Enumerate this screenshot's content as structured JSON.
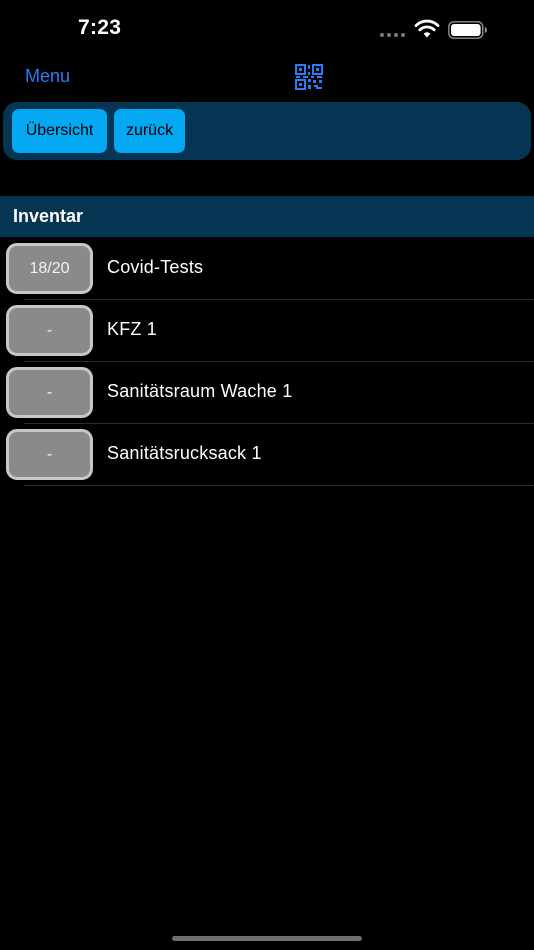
{
  "status_bar": {
    "time": "7:23",
    "icons": [
      "signal-dots-icon",
      "wifi-icon",
      "battery-icon"
    ]
  },
  "nav": {
    "menu_label": "Menu",
    "qr_icon": "qr-code-icon",
    "accent_color": "#2a7df7"
  },
  "toolbar": {
    "overview_label": "Übersicht",
    "back_label": "zurück",
    "button_color": "#04a7f2",
    "panel_color": "#053552"
  },
  "section": {
    "title": "Inventar"
  },
  "items": [
    {
      "count": "18/20",
      "label": "Covid-Tests"
    },
    {
      "count": "-",
      "label": "KFZ 1"
    },
    {
      "count": "-",
      "label": "Sanitätsraum Wache 1"
    },
    {
      "count": "-",
      "label": "Sanitätsrucksack 1"
    }
  ]
}
